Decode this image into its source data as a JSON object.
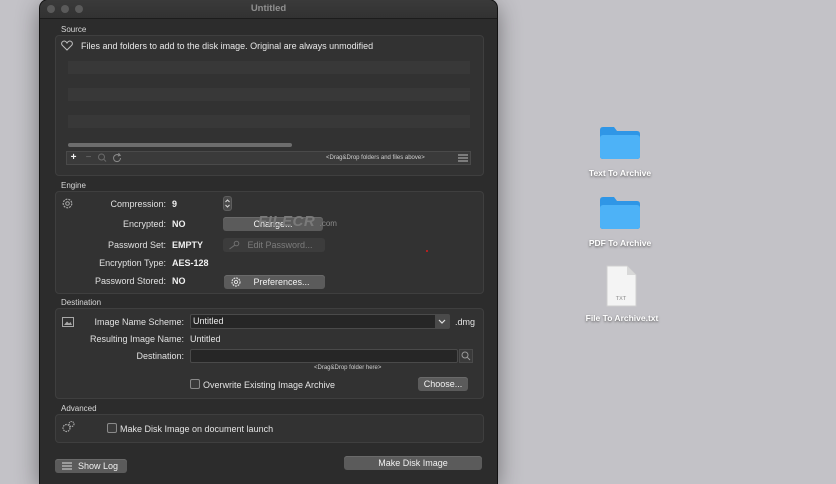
{
  "window": {
    "title": "Untitled"
  },
  "source": {
    "section_label": "Source",
    "description": "Files and folders to add to the disk image. Original are always unmodified",
    "drop_hint": "<Drag&Drop folders and files above>",
    "tools": {
      "add": "+",
      "remove": "−"
    }
  },
  "engine": {
    "section_label": "Engine",
    "compression_label": "Compression:",
    "compression_value": "9",
    "encrypted_label": "Encrypted:",
    "encrypted_value": "NO",
    "change_button": "Change...",
    "password_set_label": "Password Set:",
    "password_set_value": "EMPTY",
    "edit_password_button": "Edit Password...",
    "encryption_type_label": "Encryption Type:",
    "encryption_type_value": "AES-128",
    "password_stored_label": "Password  Stored:",
    "password_stored_value": "NO",
    "preferences_button": "Preferences..."
  },
  "watermark": {
    "text": "FILECR",
    "suffix": ".com"
  },
  "destination": {
    "section_label": "Destination",
    "scheme_label": "Image Name Scheme:",
    "scheme_value": "Untitled",
    "extension": ".dmg",
    "resulting_label": "Resulting Image Name:",
    "resulting_value": "Untitled",
    "destination_label": "Destination:",
    "destination_value": "",
    "drop_hint": "<Drag&Drop folder here>",
    "overwrite_label": "Overwrite Existing Image Archive",
    "choose_button": "Choose..."
  },
  "advanced": {
    "section_label": "Advanced",
    "make_on_launch_label": "Make Disk Image on document launch"
  },
  "footer": {
    "show_log_button": "Show Log",
    "make_disk_image_button": "Make Disk Image"
  },
  "desktop": {
    "items": [
      {
        "label": "Text To Archive",
        "kind": "folder"
      },
      {
        "label": "PDF To Archive",
        "kind": "folder"
      },
      {
        "label": "File To Archive.txt",
        "kind": "file",
        "badge": "TXT"
      }
    ]
  },
  "colors": {
    "folder": "#3fa9f5",
    "panel": "#323232",
    "window": "#2c2c2c"
  }
}
